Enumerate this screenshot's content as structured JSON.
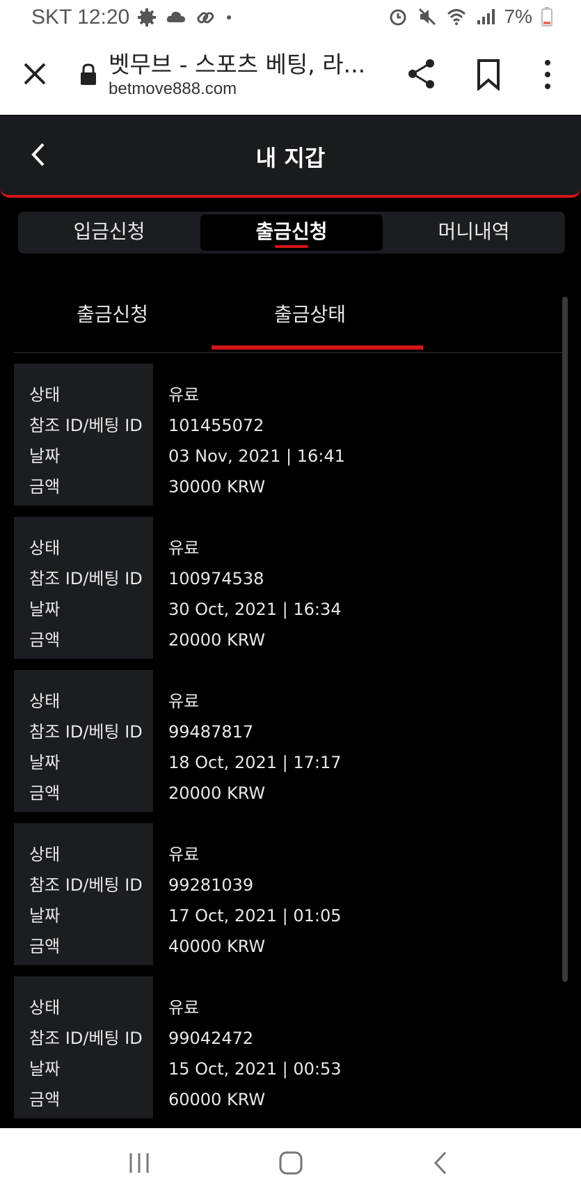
{
  "status_bar": {
    "carrier_time": "SKT 12:20",
    "battery": "7%",
    "icons_left": [
      "settings-gear-icon",
      "cloud-icon",
      "link-icon",
      "dot-icon"
    ],
    "icons_right": [
      "alarm-icon",
      "mute-icon",
      "wifi-icon",
      "signal-icon",
      "battery-icon"
    ]
  },
  "browser": {
    "title": "벳무브 - 스포츠 베팅, 라...",
    "url": "betmove888.com"
  },
  "header": {
    "title": "내 지갑"
  },
  "main_tabs": [
    {
      "label": "입금신청",
      "active": false
    },
    {
      "label": "출금신청",
      "active": true
    },
    {
      "label": "머니내역",
      "active": false
    }
  ],
  "sub_tabs": [
    {
      "label": "출금신청",
      "active": false
    },
    {
      "label": "출금상태",
      "active": true
    }
  ],
  "labels": {
    "status": "상태",
    "ref_id": "참조 ID/베팅 ID",
    "date": "날짜",
    "amount": "금액"
  },
  "records": [
    {
      "status": "유료",
      "ref_id": "101455072",
      "date": "03 Nov, 2021 | 16:41",
      "amount": "30000 KRW"
    },
    {
      "status": "유료",
      "ref_id": "100974538",
      "date": "30 Oct, 2021 | 16:34",
      "amount": "20000 KRW"
    },
    {
      "status": "유료",
      "ref_id": "99487817",
      "date": "18 Oct, 2021 | 17:17",
      "amount": "20000 KRW"
    },
    {
      "status": "유료",
      "ref_id": "99281039",
      "date": "17 Oct, 2021 | 01:05",
      "amount": "40000 KRW"
    },
    {
      "status": "유료",
      "ref_id": "99042472",
      "date": "15 Oct, 2021 | 00:53",
      "amount": "60000 KRW"
    }
  ],
  "colors": {
    "accent": "#d31418",
    "background": "#000000",
    "panel": "#1c1d21"
  }
}
